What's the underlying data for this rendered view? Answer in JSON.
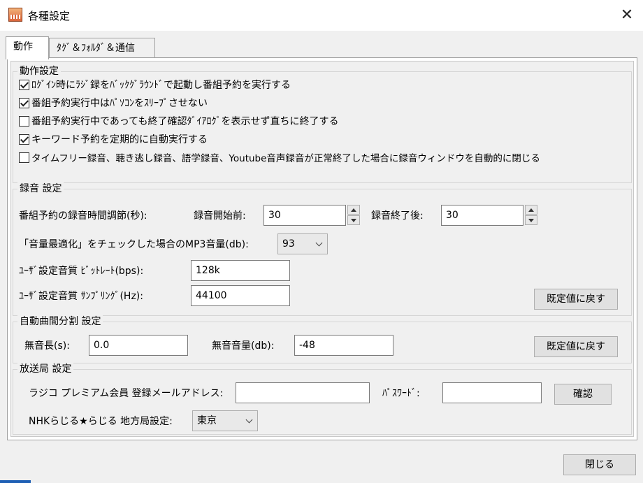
{
  "window": {
    "title": "各種設定",
    "close_glyph": "✕"
  },
  "tabs": [
    {
      "label": "動作"
    },
    {
      "label": "ﾀｸﾞ＆ﾌｫﾙﾀﾞ＆通信"
    }
  ],
  "behavior": {
    "title": "動作設定",
    "items": [
      {
        "label": "ﾛｸﾞｲﾝ時にﾗｼﾞ録をﾊﾞｯｸｸﾞﾗｳﾝﾄﾞで起動し番組予約を実行する",
        "checked": true
      },
      {
        "label": "番組予約実行中はﾊﾟｿｺﾝをｽﾘｰﾌﾟさせない",
        "checked": true
      },
      {
        "label": "番組予約実行中であっても終了確認ﾀﾞｲｱﾛｸﾞを表示せず直ちに終了する",
        "checked": false
      },
      {
        "label": "キーワード予約を定期的に自動実行する",
        "checked": true
      },
      {
        "label": "タイムフリー録音、聴き逃し録音、語学録音、Youtube音声録音が正常終了した場合に録音ウィンドウを自動的に閉じる",
        "checked": false
      }
    ]
  },
  "recording": {
    "title": "録音 設定",
    "adjust_label": "番組予約の録音時間調節(秒):",
    "start_label": "録音開始前:",
    "start_value": "30",
    "end_label": "録音終了後:",
    "end_value": "30",
    "mp3_label": "「音量最適化」をチェックした場合のMP3音量(db):",
    "mp3_value": "93",
    "bitrate_label": "ﾕｰｻﾞ設定音質 ﾋﾞｯﾄﾚｰﾄ(bps):",
    "bitrate_value": "128k",
    "sampling_label": "ﾕｰｻﾞ設定音質 ｻﾝﾌﾟﾘﾝｸﾞ(Hz):",
    "sampling_value": "44100",
    "reset_label": "既定値に戻す"
  },
  "split": {
    "title": "自動曲間分割 設定",
    "silence_length_label": "無音長(s):",
    "silence_length_value": "0.0",
    "silence_volume_label": "無音音量(db):",
    "silence_volume_value": "-48",
    "reset_label": "既定値に戻す"
  },
  "station": {
    "title": "放送局 設定",
    "email_label": "ラジコ プレミアム会員 登録メールアドレス:",
    "email_value": "",
    "password_label": "ﾊﾟｽﾜｰﾄﾞ:",
    "password_value": "",
    "confirm_label": "確認",
    "nhk_label": "NHKらじる★らじる 地方局設定:",
    "nhk_value": "東京"
  },
  "footer": {
    "close_label": "閉じる"
  }
}
